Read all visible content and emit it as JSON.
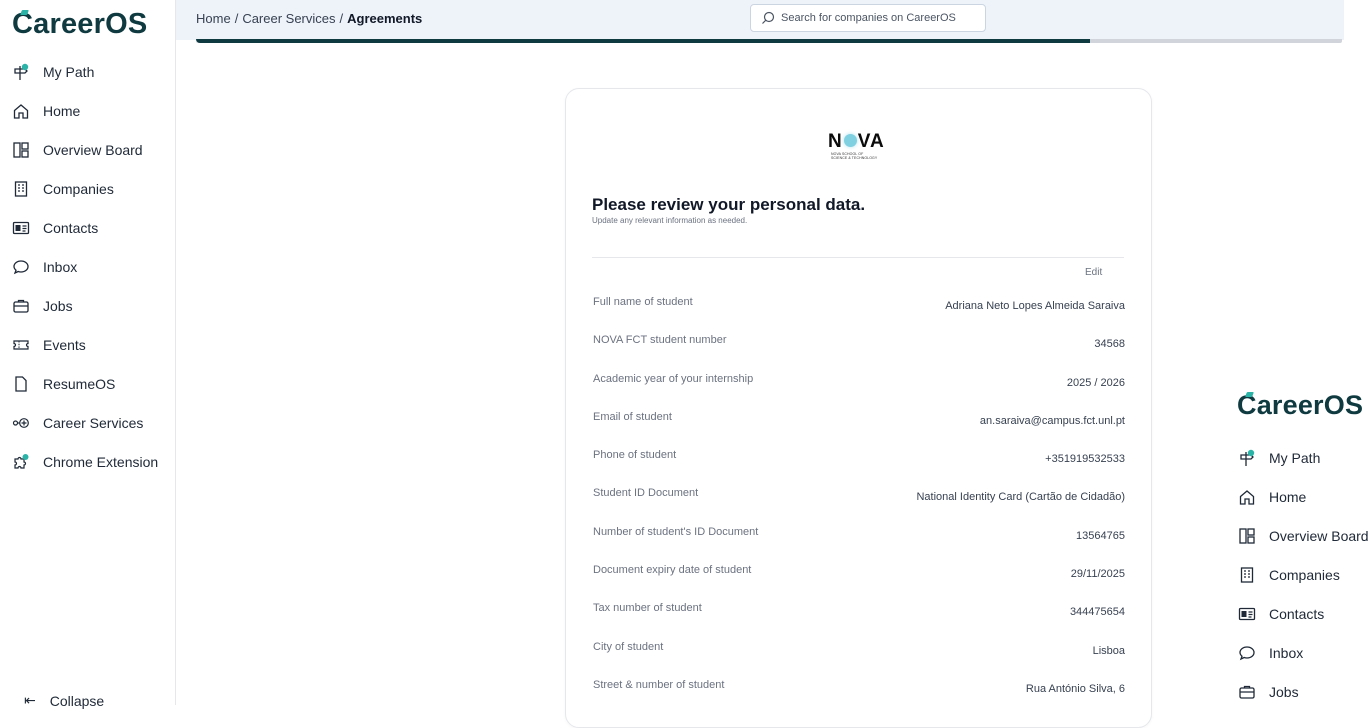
{
  "app": {
    "logo": "CareerOS"
  },
  "sidebar": {
    "items": [
      {
        "label": "My Path",
        "icon": "signpost-icon"
      },
      {
        "label": "Home",
        "icon": "home-icon"
      },
      {
        "label": "Overview Board",
        "icon": "board-icon"
      },
      {
        "label": "Companies",
        "icon": "building-icon"
      },
      {
        "label": "Contacts",
        "icon": "contact-card-icon"
      },
      {
        "label": "Inbox",
        "icon": "chat-bubble-icon"
      },
      {
        "label": "Jobs",
        "icon": "briefcase-icon"
      },
      {
        "label": "Events",
        "icon": "ticket-icon"
      },
      {
        "label": "ResumeOS",
        "icon": "document-icon"
      },
      {
        "label": "Career Services",
        "icon": "career-services-icon"
      },
      {
        "label": "Chrome Extension",
        "icon": "puzzle-icon"
      }
    ],
    "collapse_label": "Collapse",
    "accent": "#2bb3a8"
  },
  "header": {
    "breadcrumb": [
      "Home",
      "Career Services",
      "Agreements"
    ],
    "search_placeholder": "Search for companies on CareerOS",
    "progress_pct": 78
  },
  "card": {
    "logo_word": "NOVA",
    "logo_sub_1": "NOVA SCHOOL OF",
    "logo_sub_2": "SCIENCE & TECHNOLOGY",
    "title": "Please review your personal data.",
    "subtitle": "Update any relevant information as needed.",
    "edit_label": "Edit",
    "fields": [
      {
        "label": "Full name of student",
        "value": "Adriana Neto Lopes Almeida Saraiva"
      },
      {
        "label": "NOVA FCT student number",
        "value": "34568"
      },
      {
        "label": "Academic year of your internship",
        "value": "2025 / 2026"
      },
      {
        "label": "Email of student",
        "value": "an.saraiva@campus.fct.unl.pt"
      },
      {
        "label": "Phone of student",
        "value": "+351919532533"
      },
      {
        "label": "Student ID Document",
        "value": "National Identity Card (Cartão de Cidadão)"
      },
      {
        "label": "Number of student's ID Document",
        "value": "13564765"
      },
      {
        "label": "Document expiry date of student",
        "value": "29/11/2025"
      },
      {
        "label": "Tax number of student",
        "value": "344475654"
      },
      {
        "label": "City of student",
        "value": "Lisboa"
      },
      {
        "label": "Street & number of student",
        "value": "Rua António Silva, 6"
      }
    ]
  },
  "right_sidebar": {
    "items": [
      {
        "label": "My Path"
      },
      {
        "label": "Home"
      },
      {
        "label": "Overview Board"
      },
      {
        "label": "Companies"
      },
      {
        "label": "Contacts"
      },
      {
        "label": "Inbox"
      },
      {
        "label": "Jobs"
      }
    ]
  }
}
